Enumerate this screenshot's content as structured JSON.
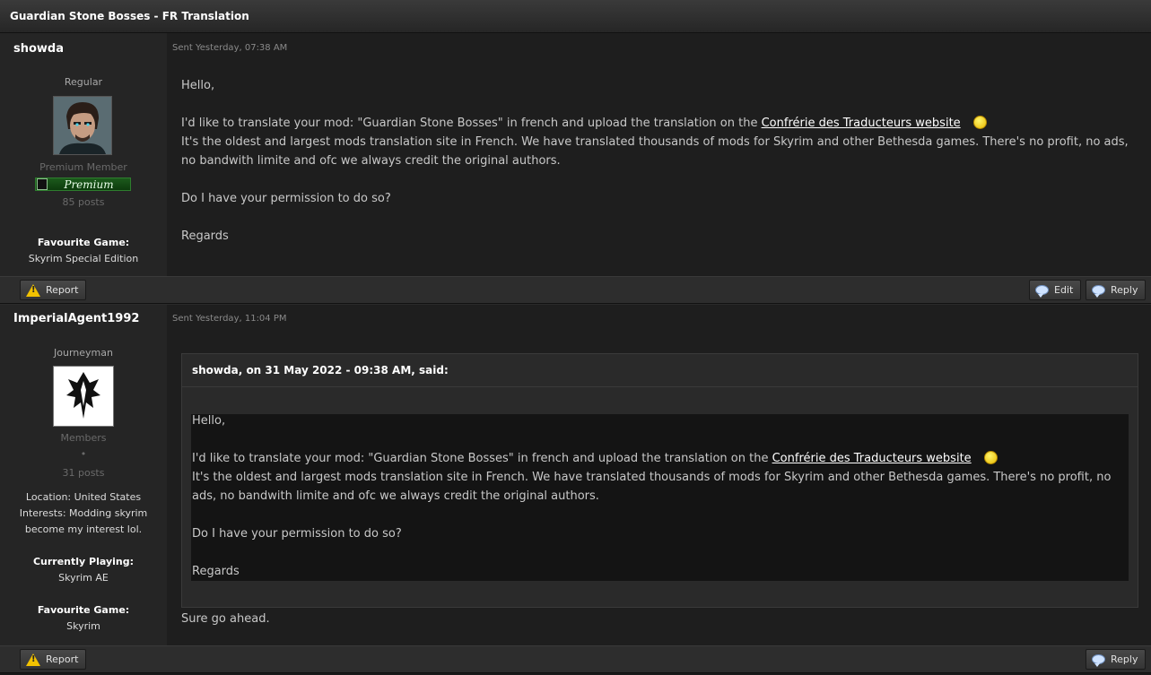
{
  "topic_title": "Guardian Stone Bosses - FR Translation",
  "posts": [
    {
      "author": "showda",
      "sent": "Sent Yesterday, 07:38 AM",
      "rank": "Regular",
      "group": "Premium Member",
      "badge": "Premium",
      "posts_count": "85 posts",
      "fields": [
        {
          "label": "Favourite Game:",
          "value": "Skyrim Special Edition"
        }
      ],
      "body": {
        "greeting": "Hello,",
        "line1_pre": "I'd like to translate your mod: \"Guardian Stone Bosses\" in french and upload the translation on the ",
        "link": "Confrérie des Traducteurs website",
        "line2": "It's the oldest and largest mods translation site in French. We have translated thousands of mods for Skyrim and other Bethesda games. There's no profit, no ads, no bandwith limite and ofc we always credit the original authors.",
        "question": "Do I have your permission to do so?",
        "closing": "Regards"
      },
      "actions": {
        "report": "Report",
        "edit": "Edit",
        "reply": "Reply"
      }
    },
    {
      "author": "ImperialAgent1992",
      "sent": "Sent Yesterday, 11:04 PM",
      "rank": "Journeyman",
      "group": "Members",
      "pip": "•",
      "posts_count": "31 posts",
      "location": "Location: United States",
      "interests_1": "Interests: Modding skyrim",
      "interests_2": "become my interest lol.",
      "fields": [
        {
          "label": "Currently Playing:",
          "value": "Skyrim AE"
        },
        {
          "label": "Favourite Game:",
          "value": "Skyrim"
        }
      ],
      "quote": {
        "header": "showda, on 31 May 2022 - 09:38 AM, said:"
      },
      "reply_text": "Sure go ahead.",
      "actions": {
        "report": "Report",
        "reply": "Reply"
      }
    }
  ],
  "colors": {
    "background": "#1e1e1e",
    "sidebar": "#252525",
    "badge_green": "#1c5a1c",
    "warning": "#f2c200"
  },
  "icons": [
    "warning-icon",
    "edit-bubble-icon",
    "reply-bubble-icon",
    "smiley-icon",
    "skyrim-dragon-logo"
  ]
}
